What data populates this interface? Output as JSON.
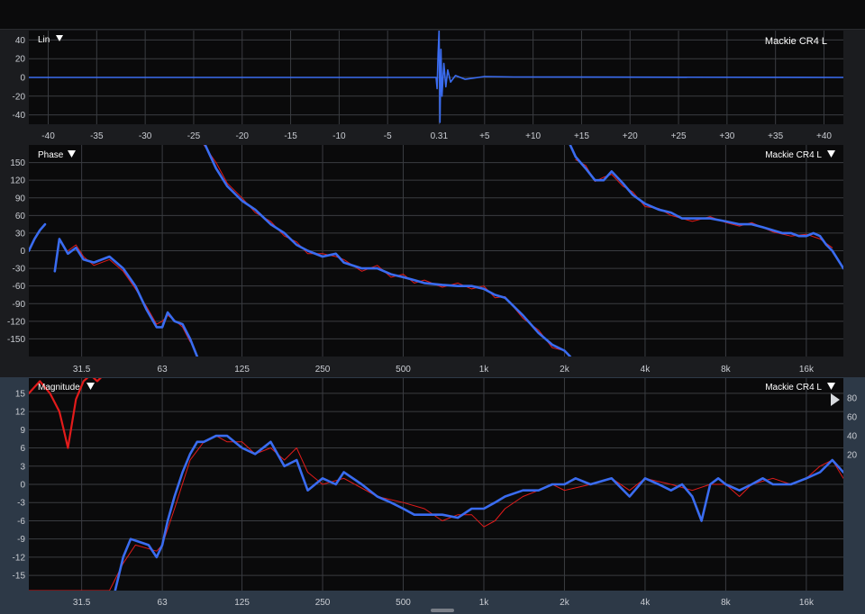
{
  "colors": {
    "measurement": "#3a6cf0",
    "reference": "#e21b1b",
    "background": "#0a0a0b",
    "bottom_panel": "#2d3947"
  },
  "panel_labels": {
    "impulse_mode": "Lin",
    "impulse_title": "Mackie CR4 L",
    "phase": "Phase",
    "phase_trace": "Mackie CR4 L",
    "magnitude": "Magnitude",
    "magnitude_trace": "Mackie CR4 L"
  },
  "icons": [
    "dropdown-triangle-icon",
    "play-marker-icon"
  ],
  "chart_data": [
    {
      "name": "impulse",
      "type": "line",
      "title": "Mackie CR4 L",
      "xlabel": "",
      "ylabel": "",
      "xlim": [
        -42,
        42
      ],
      "ylim": [
        -50,
        50
      ],
      "x_ticks": [
        -40,
        -35,
        -30,
        -25,
        -20,
        -15,
        -10,
        -5,
        0.31,
        5,
        10,
        15,
        20,
        25,
        30,
        35,
        40
      ],
      "x_tick_labels": [
        "-40",
        "-35",
        "-30",
        "-25",
        "-20",
        "-15",
        "-10",
        "-5",
        "0.31",
        "+5",
        "+10",
        "+15",
        "+20",
        "+25",
        "+30",
        "+35",
        "+40"
      ],
      "y_ticks": [
        40,
        20,
        0,
        -20,
        -40
      ],
      "y_tick_labels": [
        "40",
        "20",
        "0",
        "-20",
        "-40"
      ],
      "grid": true,
      "series": [
        {
          "name": "Mackie CR4 L",
          "color": "#3a6cf0",
          "x": [
            -42,
            0.0,
            0.1,
            0.2,
            0.31,
            0.4,
            0.5,
            0.6,
            0.8,
            1.0,
            1.2,
            1.5,
            2,
            3,
            5,
            8,
            42
          ],
          "y": [
            0,
            0,
            -12,
            25,
            50,
            -48,
            30,
            -20,
            15,
            -10,
            8,
            -5,
            2,
            -2,
            1,
            0.5,
            0
          ]
        }
      ]
    },
    {
      "name": "phase",
      "type": "line",
      "title": "Phase",
      "xlabel": "",
      "ylabel": "",
      "x_scale": "log",
      "xlim": [
        20,
        22000
      ],
      "ylim": [
        -180,
        180
      ],
      "x_ticks": [
        31.5,
        63,
        125,
        250,
        500,
        1000,
        2000,
        4000,
        8000,
        16000
      ],
      "x_tick_labels": [
        "31.5",
        "63",
        "125",
        "250",
        "500",
        "1k",
        "2k",
        "4k",
        "8k",
        "16k"
      ],
      "y_ticks": [
        150,
        120,
        90,
        60,
        30,
        0,
        -30,
        -60,
        -90,
        -120,
        -150
      ],
      "y_tick_labels": [
        "150",
        "120",
        "90",
        "60",
        "30",
        "0",
        "-30",
        "-60",
        "-90",
        "-120",
        "-150"
      ],
      "grid": true,
      "series": [
        {
          "name": "Mackie CR4 L",
          "color": "#3a6cf0",
          "segments": [
            {
              "x": [
                20,
                21,
                22,
                23
              ],
              "y": [
                0,
                20,
                35,
                45
              ]
            },
            {
              "x": [
                25,
                26,
                28,
                30,
                32,
                35,
                40,
                45,
                50,
                55,
                60,
                63,
                66,
                70,
                75,
                80,
                85
              ],
              "y": [
                -35,
                20,
                -5,
                5,
                -15,
                -20,
                -10,
                -30,
                -60,
                -100,
                -130,
                -130,
                -105,
                -120,
                -125,
                -150,
                -180
              ]
            },
            {
              "x": [
                90,
                100,
                110,
                125,
                140,
                160,
                180,
                200,
                220,
                250,
                280,
                300,
                350,
                400,
                450,
                500,
                550,
                600,
                700,
                800,
                900,
                1000,
                1100,
                1200,
                1400,
                1600,
                1800,
                2000,
                2100
              ],
              "y": [
                185,
                140,
                110,
                85,
                70,
                45,
                30,
                10,
                0,
                -10,
                -5,
                -20,
                -30,
                -30,
                -40,
                -45,
                -50,
                -55,
                -58,
                -60,
                -60,
                -65,
                -75,
                -80,
                -110,
                -140,
                -160,
                -170,
                -180
              ]
            },
            {
              "x": [
                2100,
                2200,
                2400,
                2600,
                2800,
                3000,
                3300,
                3600,
                4000,
                4500,
                5000,
                5500,
                6000,
                7000,
                8000,
                9000,
                10000,
                11000,
                12000,
                13000,
                14000,
                15000,
                16000,
                17000,
                18000,
                19000,
                20000,
                22000
              ],
              "y": [
                180,
                160,
                140,
                120,
                120,
                135,
                115,
                95,
                80,
                70,
                65,
                55,
                55,
                55,
                50,
                45,
                45,
                40,
                35,
                30,
                30,
                25,
                25,
                30,
                25,
                10,
                0,
                -30
              ]
            }
          ]
        },
        {
          "name": "reference",
          "color": "#e21b1b",
          "segments": [
            {
              "x": [
                28,
                30,
                32,
                35,
                40,
                45,
                50,
                55,
                60,
                63,
                66,
                70,
                75,
                80
              ],
              "y": [
                0,
                10,
                -10,
                -25,
                -15,
                -35,
                -65,
                -95,
                -125,
                -120,
                -110,
                -118,
                -130,
                -155
              ]
            },
            {
              "x": [
                90,
                100,
                110,
                125,
                140,
                160,
                180,
                200,
                220,
                250,
                280,
                300,
                350,
                400,
                450,
                500,
                550,
                600,
                700,
                800,
                900,
                1000,
                1100,
                1200,
                1400,
                1600,
                1800,
                2000
              ],
              "y": [
                180,
                150,
                115,
                90,
                65,
                50,
                25,
                15,
                -5,
                -5,
                -10,
                -15,
                -35,
                -25,
                -45,
                -40,
                -55,
                -50,
                -62,
                -55,
                -65,
                -60,
                -80,
                -78,
                -115,
                -135,
                -165,
                -170
              ]
            },
            {
              "x": [
                2200,
                2400,
                2600,
                2800,
                3000,
                3300,
                3600,
                4000,
                4500,
                5000,
                6000,
                7000,
                8000,
                9000,
                10000,
                12000,
                14000,
                16000,
                18000,
                20000
              ],
              "y": [
                155,
                145,
                118,
                125,
                130,
                110,
                100,
                75,
                72,
                60,
                50,
                58,
                48,
                42,
                48,
                32,
                25,
                28,
                20,
                5
              ]
            }
          ]
        }
      ]
    },
    {
      "name": "magnitude",
      "type": "line",
      "title": "Magnitude",
      "xlabel": "",
      "ylabel": "",
      "x_scale": "log",
      "xlim": [
        20,
        22000
      ],
      "ylim": [
        -17.5,
        17.5
      ],
      "x_ticks": [
        31.5,
        63,
        125,
        250,
        500,
        1000,
        2000,
        4000,
        8000,
        16000
      ],
      "x_tick_labels": [
        "31.5",
        "63",
        "125",
        "250",
        "500",
        "1k",
        "2k",
        "4k",
        "8k",
        "16k"
      ],
      "y_ticks": [
        15,
        12,
        9,
        6,
        3,
        0,
        -3,
        -6,
        -9,
        -12,
        -15
      ],
      "y_tick_labels": [
        "15",
        "12",
        "9",
        "6",
        "3",
        "0",
        "-3",
        "-6",
        "-9",
        "-12",
        "-15"
      ],
      "y2_ticks": [
        80,
        60,
        40,
        20
      ],
      "y2_tick_labels": [
        "80",
        "60",
        "40",
        "20"
      ],
      "grid": true,
      "series": [
        {
          "name": "Mackie CR4 L",
          "color": "#3a6cf0",
          "x": [
            42,
            45,
            48,
            52,
            56,
            60,
            63,
            66,
            70,
            75,
            80,
            85,
            90,
            100,
            110,
            125,
            140,
            160,
            180,
            200,
            220,
            250,
            280,
            300,
            350,
            400,
            450,
            500,
            550,
            600,
            700,
            800,
            900,
            1000,
            1100,
            1200,
            1400,
            1600,
            1800,
            2000,
            2200,
            2500,
            3000,
            3500,
            4000,
            4500,
            5000,
            5500,
            6000,
            6500,
            7000,
            7500,
            8000,
            9000,
            10000,
            11000,
            12000,
            14000,
            16000,
            18000,
            20000,
            22000
          ],
          "y": [
            -17.5,
            -12,
            -9,
            -9.5,
            -10,
            -12,
            -10,
            -6,
            -2,
            2,
            5,
            7,
            7,
            8,
            8,
            6,
            5,
            7,
            3,
            4,
            -1,
            1,
            0,
            2,
            0,
            -2,
            -3,
            -4,
            -5,
            -5,
            -5,
            -5.5,
            -4,
            -4,
            -3,
            -2,
            -1,
            -1,
            0,
            0,
            1,
            0,
            1,
            -2,
            1,
            0,
            -1,
            0,
            -2,
            -6,
            0,
            1,
            0,
            -1,
            0,
            1,
            0,
            0,
            1,
            2,
            4,
            2
          ]
        },
        {
          "name": "reference",
          "color": "#e21b1b",
          "x": [
            20,
            22,
            24,
            26,
            27,
            28,
            30,
            32,
            34,
            36,
            38,
            40,
            45,
            50,
            55,
            60,
            63,
            70,
            80,
            90,
            100,
            110,
            125,
            140,
            160,
            180,
            200,
            220,
            250,
            300,
            400,
            500,
            600,
            700,
            800,
            900,
            1000,
            1100,
            1200,
            1400,
            1600,
            1800,
            2000,
            2500,
            3000,
            3500,
            4000,
            5000,
            6000,
            7000,
            8000,
            9000,
            10000,
            12000,
            14000,
            16000,
            18000,
            20000,
            22000
          ],
          "y": [
            -17.5,
            -17.5,
            -17.5,
            -17.5,
            -17.5,
            -17.5,
            -17.5,
            -17.5,
            -17.5,
            -17.5,
            -17.5,
            -17.5,
            -13,
            -10,
            -10.5,
            -11,
            -10,
            -4,
            4,
            7,
            8,
            7,
            7,
            5,
            6,
            4,
            6,
            2,
            0,
            1,
            -2,
            -3,
            -4,
            -6,
            -5,
            -5,
            -7,
            -6,
            -4,
            -2,
            -1,
            0,
            -1,
            0,
            1,
            -1,
            1,
            0,
            -1,
            0,
            0,
            -2,
            0,
            1,
            0,
            1,
            3,
            4,
            1
          ]
        },
        {
          "name": "reference-level",
          "color": "#e21b1b",
          "x": [
            20,
            22,
            24,
            26,
            27,
            28,
            30,
            32,
            34,
            36,
            38,
            40,
            45,
            50,
            60,
            80,
            100,
            1000,
            10000,
            22000
          ],
          "y": [
            15,
            17,
            15,
            12,
            9,
            6,
            14,
            17,
            18,
            17,
            18,
            18,
            19,
            19.5,
            19.5,
            19.5,
            19.5,
            19.5,
            19.5,
            19.5
          ]
        }
      ]
    }
  ]
}
